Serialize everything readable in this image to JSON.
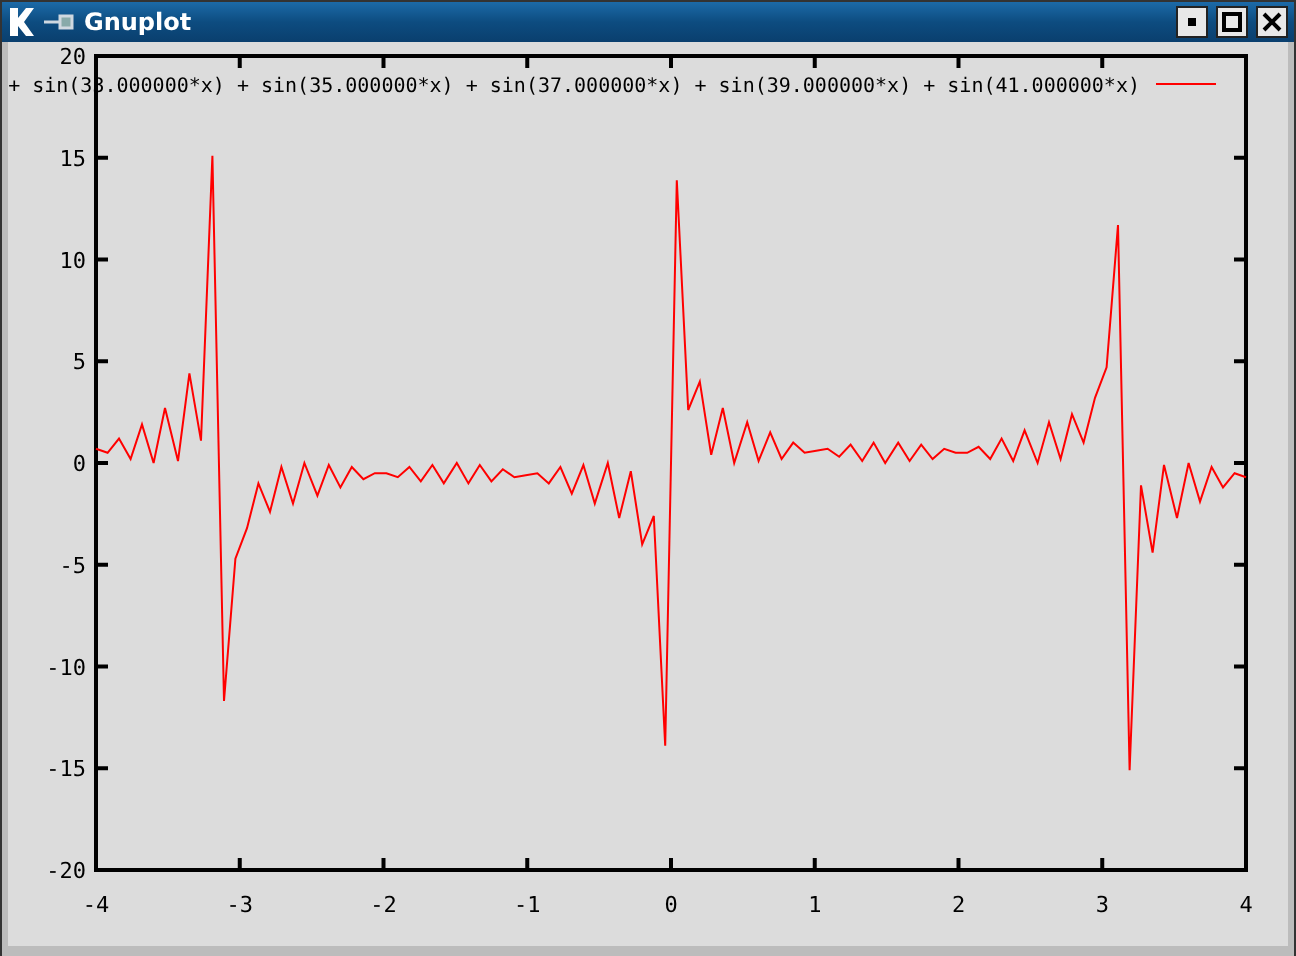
{
  "window": {
    "title": "Gnuplot"
  },
  "chart_data": {
    "type": "line",
    "xlim": [
      -4,
      4
    ],
    "ylim": [
      -20,
      20
    ],
    "xticks": [
      -4,
      -3,
      -2,
      -1,
      0,
      1,
      2,
      3,
      4
    ],
    "yticks": [
      -20,
      -15,
      -10,
      -5,
      0,
      5,
      10,
      15,
      20
    ],
    "x": [
      -4.0,
      -3.92,
      -3.84,
      -3.76,
      -3.68,
      -3.6,
      -3.52,
      -3.43,
      -3.35,
      -3.27,
      -3.19,
      -3.11,
      -3.03,
      -2.95,
      -2.87,
      -2.79,
      -2.71,
      -2.63,
      -2.55,
      -2.46,
      -2.38,
      -2.3,
      -2.22,
      -2.14,
      -2.06,
      -1.98,
      -1.9,
      -1.82,
      -1.74,
      -1.66,
      -1.58,
      -1.49,
      -1.41,
      -1.33,
      -1.25,
      -1.17,
      -1.09,
      -1.01,
      -0.93,
      -0.85,
      -0.77,
      -0.69,
      -0.61,
      -0.53,
      -0.44,
      -0.36,
      -0.28,
      -0.2,
      -0.12,
      -0.04,
      0.04,
      0.12,
      0.2,
      0.28,
      0.36,
      0.44,
      0.53,
      0.61,
      0.69,
      0.77,
      0.85,
      0.93,
      1.01,
      1.09,
      1.17,
      1.25,
      1.33,
      1.41,
      1.49,
      1.58,
      1.66,
      1.74,
      1.82,
      1.9,
      1.98,
      2.06,
      2.14,
      2.22,
      2.3,
      2.38,
      2.46,
      2.55,
      2.63,
      2.71,
      2.79,
      2.87,
      2.95,
      3.03,
      3.11,
      3.19,
      3.27,
      3.35,
      3.43,
      3.52,
      3.6,
      3.68,
      3.76,
      3.84,
      3.92,
      4.0
    ],
    "series": [
      {
        "name": "+ sin(33.000000*x) + sin(35.000000*x) + sin(37.000000*x) + sin(39.000000*x) + sin(41.000000*x)",
        "color": "#ff0000",
        "values": [
          0.7,
          0.5,
          1.2,
          0.2,
          1.9,
          0.0,
          2.7,
          0.1,
          4.4,
          1.1,
          15.1,
          -11.7,
          -4.7,
          -3.2,
          -1.0,
          -2.4,
          -0.2,
          -2.0,
          0.0,
          -1.6,
          -0.1,
          -1.2,
          -0.2,
          -0.8,
          -0.5,
          -0.5,
          -0.7,
          -0.2,
          -0.9,
          -0.1,
          -1.0,
          0.0,
          -1.0,
          -0.1,
          -0.9,
          -0.3,
          -0.7,
          -0.6,
          -0.5,
          -1.0,
          -0.2,
          -1.5,
          -0.1,
          -2.0,
          0.0,
          -2.7,
          -0.4,
          -4.0,
          -2.6,
          -13.9,
          13.9,
          2.6,
          4.0,
          0.4,
          2.7,
          0.0,
          2.0,
          0.1,
          1.5,
          0.2,
          1.0,
          0.5,
          0.6,
          0.7,
          0.3,
          0.9,
          0.1,
          1.0,
          0.0,
          1.0,
          0.1,
          0.9,
          0.2,
          0.7,
          0.5,
          0.5,
          0.8,
          0.2,
          1.2,
          0.1,
          1.6,
          0.0,
          2.0,
          0.2,
          2.4,
          1.0,
          3.2,
          4.7,
          11.7,
          -15.1,
          -1.1,
          -4.4,
          -0.1,
          -2.7,
          0.0,
          -1.9,
          -0.2,
          -1.2,
          -0.5,
          -0.7
        ]
      }
    ]
  }
}
